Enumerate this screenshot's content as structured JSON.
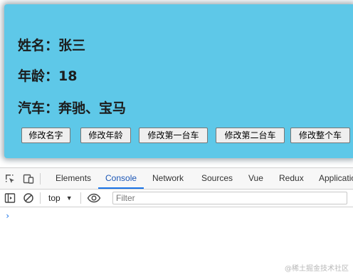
{
  "app": {
    "name_label": "姓名：张三",
    "age_label": "年龄：18",
    "car_label": "汽车：奔驰、宝马",
    "buttons": {
      "change_name": "修改名字",
      "change_age": "修改年龄",
      "change_first_car": "修改第一台车",
      "change_second_car": "修改第二台车",
      "change_all_cars": "修改整个车"
    },
    "background_color": "#5ec8e8"
  },
  "devtools": {
    "tabs": {
      "elements": "Elements",
      "console": "Console",
      "network": "Network",
      "sources": "Sources",
      "vue": "Vue",
      "redux": "Redux",
      "application": "Application"
    },
    "active_tab": "Console",
    "toolbar": {
      "context": "top",
      "filter_placeholder": "Filter"
    },
    "prompt": "›",
    "icons": [
      "inspect-icon",
      "device-toggle-icon",
      "sidebar-toggle-icon",
      "clear-console-icon",
      "eye-icon",
      "dropdown-arrow-icon"
    ]
  },
  "watermark": "@稀土掘金技术社区"
}
